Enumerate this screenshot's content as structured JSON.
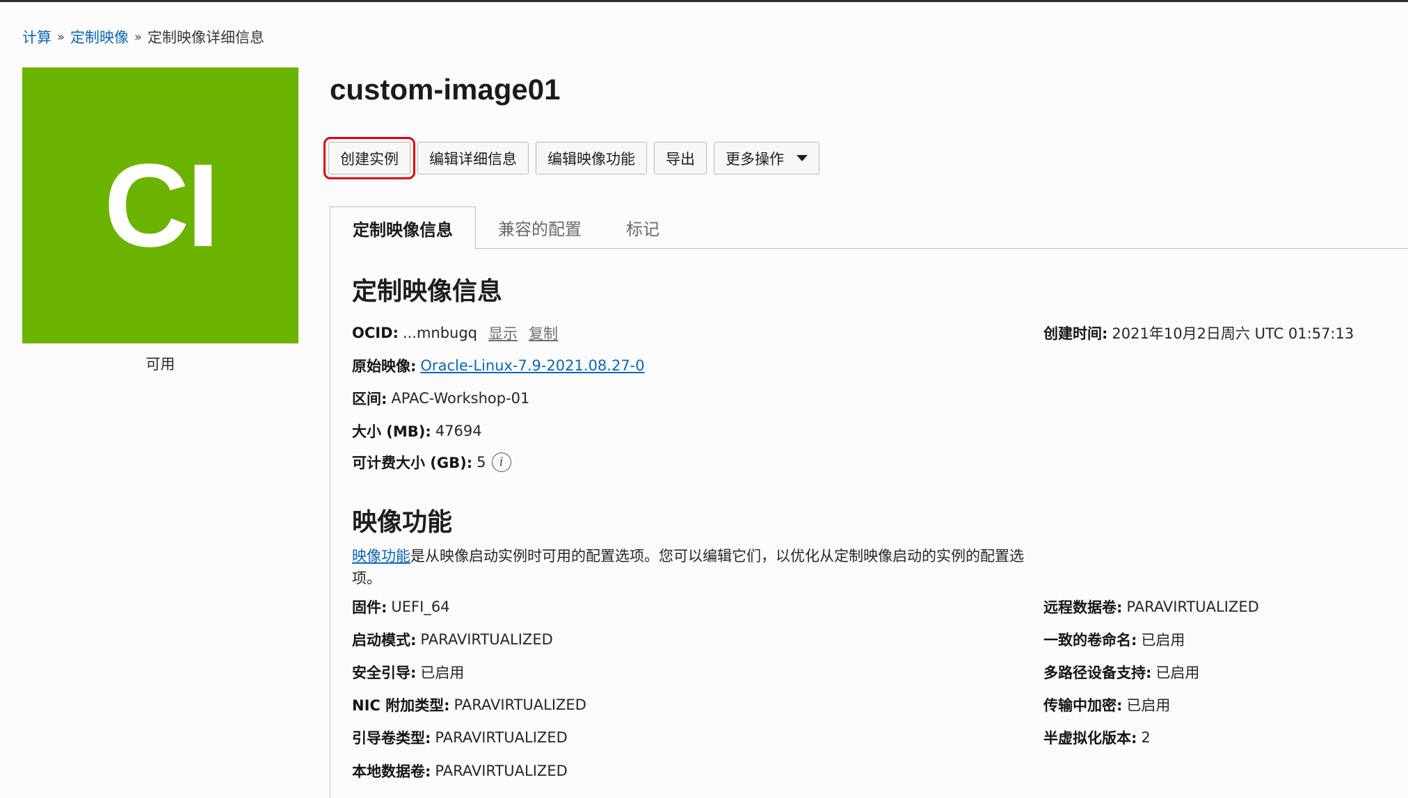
{
  "breadcrumb": {
    "compute": "计算",
    "custom_images": "定制映像",
    "current": "定制映像详细信息",
    "separator": "»"
  },
  "badge": {
    "initials": "CI",
    "color": "#6ab400",
    "status": "可用"
  },
  "title": "custom-image01",
  "actions": {
    "create_instance": "创建实例",
    "edit_details": "编辑详细信息",
    "edit_capabilities": "编辑映像功能",
    "export": "导出",
    "more_actions": "更多操作"
  },
  "tabs": [
    "定制映像信息",
    "兼容的配置",
    "标记"
  ],
  "info": {
    "heading": "定制映像信息",
    "ocid_label": "OCID:",
    "ocid_value": "...mnbugq",
    "show": "显示",
    "copy": "复制",
    "created_label": "创建时间:",
    "created_value": "2021年10月2日周六 UTC 01:57:13",
    "base_image_label": "原始映像:",
    "base_image_value": "Oracle-Linux-7.9-2021.08.27-0",
    "compartment_label": "区间:",
    "compartment_value": "APAC-Workshop-01",
    "size_label": "大小 (MB):",
    "size_value": "47694",
    "billable_label": "可计费大小 (GB):",
    "billable_value": "5",
    "info_icon": "i"
  },
  "capabilities": {
    "heading": "映像功能",
    "desc_link": "映像功能",
    "desc_text": "是从映像启动实例时可用的配置选项。您可以编辑它们，以优化从定制映像启动的实例的配置选项。",
    "left": [
      {
        "label": "固件:",
        "value": "UEFI_64"
      },
      {
        "label": "启动模式:",
        "value": "PARAVIRTUALIZED"
      },
      {
        "label": "安全引导:",
        "value": "已启用"
      },
      {
        "label": "NIC 附加类型:",
        "value": "PARAVIRTUALIZED"
      },
      {
        "label": "引导卷类型:",
        "value": "PARAVIRTUALIZED"
      },
      {
        "label": "本地数据卷:",
        "value": "PARAVIRTUALIZED"
      }
    ],
    "right": [
      {
        "label": "远程数据卷:",
        "value": "PARAVIRTUALIZED"
      },
      {
        "label": "一致的卷命名:",
        "value": "已启用"
      },
      {
        "label": "多路径设备支持:",
        "value": "已启用"
      },
      {
        "label": "传输中加密:",
        "value": "已启用"
      },
      {
        "label": "半虚拟化版本:",
        "value": "2"
      }
    ]
  }
}
